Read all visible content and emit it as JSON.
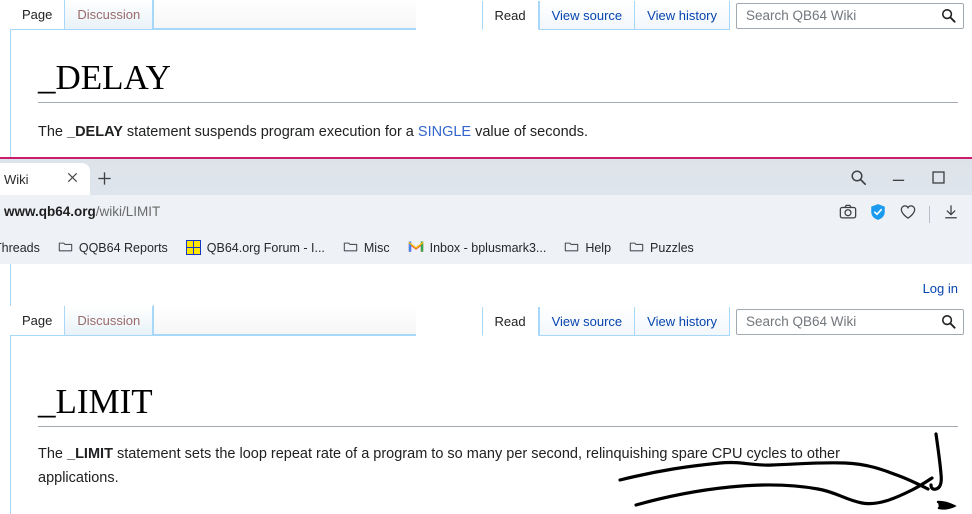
{
  "top_page": {
    "namespace_tabs": [
      {
        "label": "Page",
        "state": "selected"
      },
      {
        "label": "Discussion",
        "state": "unselected"
      }
    ],
    "view_tabs": [
      {
        "label": "Read",
        "state": "selected"
      },
      {
        "label": "View source",
        "state": "link"
      },
      {
        "label": "View history",
        "state": "link"
      }
    ],
    "search": {
      "placeholder": "Search QB64 Wiki",
      "value": "",
      "icon": "search-icon"
    },
    "title": "_DELAY",
    "paragraph": {
      "before": "The ",
      "keyword": "_DELAY",
      "middle": " statement suspends program execution for a ",
      "link": "SINGLE",
      "after": " value of seconds."
    }
  },
  "browser": {
    "accent_line_color": "#cc1b6b",
    "tab": {
      "title": "Wiki",
      "close_icon": "close-icon"
    },
    "new_tab_label": "+",
    "window_controls": [
      {
        "name": "search-icon",
        "glyph": "search"
      },
      {
        "name": "minimize-icon",
        "glyph": "minimize"
      },
      {
        "name": "maximize-icon",
        "glyph": "maximize"
      }
    ],
    "address": {
      "domain": "www.qb64.org",
      "path": "/wiki/LIMIT"
    },
    "address_icons": [
      {
        "name": "screenshot-camera-icon"
      },
      {
        "name": "verified-shield-icon",
        "color": "#1a9bf0"
      },
      {
        "name": "favorites-heart-icon"
      },
      {
        "name": "downloads-icon"
      }
    ],
    "bookmarks": [
      {
        "label": "Threads",
        "icon": "folder-icon",
        "truncated_left": true
      },
      {
        "label": "QQB64 Reports",
        "icon": "folder-icon"
      },
      {
        "label": "QB64.org Forum - I...",
        "icon": "qb64-favicon"
      },
      {
        "label": "Misc",
        "icon": "folder-icon"
      },
      {
        "label": "Inbox - bplusmark3...",
        "icon": "gmail-icon"
      },
      {
        "label": "Help",
        "icon": "folder-icon"
      },
      {
        "label": "Puzzles",
        "icon": "folder-icon"
      }
    ]
  },
  "bottom_page": {
    "login_label": "Log in",
    "namespace_tabs": [
      {
        "label": "Page",
        "state": "selected"
      },
      {
        "label": "Discussion",
        "state": "unselected"
      }
    ],
    "view_tabs": [
      {
        "label": "Read",
        "state": "selected"
      },
      {
        "label": "View source",
        "state": "link"
      },
      {
        "label": "View history",
        "state": "link"
      }
    ],
    "search": {
      "placeholder": "Search QB64 Wiki",
      "value": "",
      "icon": "search-icon"
    },
    "title": "_LIMIT",
    "paragraph": {
      "before": "The ",
      "keyword": "_LIMIT",
      "after": " statement sets the loop repeat rate of a program to so many per second, relinquishing spare CPU cycles to other applications."
    }
  },
  "annotation": {
    "ink_color": "#000000",
    "strokes": [
      "wavy-line-upper",
      "wavy-line-lower",
      "vertical-hook",
      "small-tick"
    ]
  }
}
